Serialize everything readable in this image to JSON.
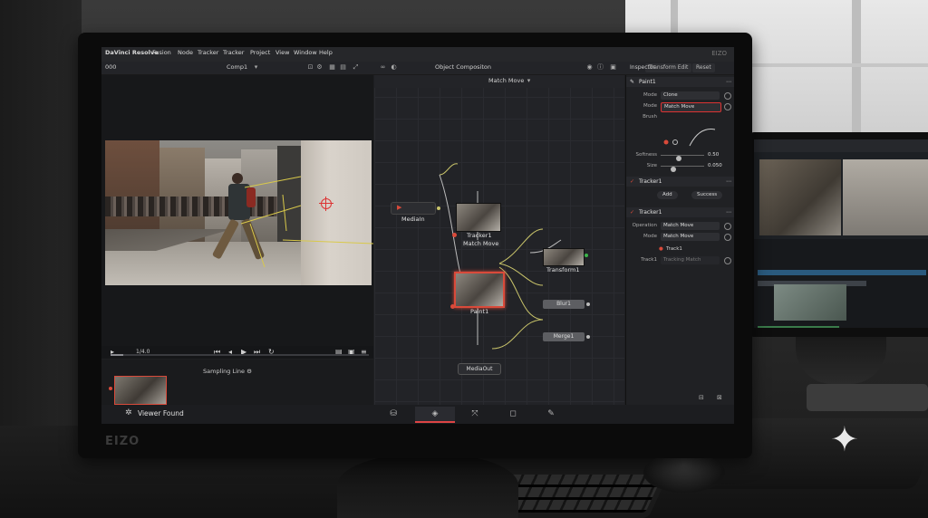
{
  "monitor": {
    "brand": "EIZO"
  },
  "menubar": {
    "items": [
      "DaVinci Resolve",
      "Fusion",
      "Node",
      "Tracker",
      "Tracker",
      "Project",
      "View",
      "Window",
      "Help"
    ]
  },
  "toolbar": {
    "left_label": "000",
    "viewer_name": "Comp1",
    "comp_title": "Object Compositon",
    "match_move_label": "Match Move",
    "inspector_tab": "Inspector",
    "transform_tab": "Transform Edit",
    "reset_button": "Reset"
  },
  "viewer": {
    "frame_counter": "1/4.0",
    "sampling_label": "Sampling Line",
    "playhead_fraction": 0.05
  },
  "statusbar": {
    "viewer_status": "Viewer Found"
  },
  "nodes": {
    "media_in": "MediaIn",
    "tracker": "Tracker1",
    "tracker_sub": "Match Move",
    "paint": "Paint1",
    "transform": "Transform1",
    "blur": "Blur1",
    "merge": "Merge1",
    "media_out": "MediaOut"
  },
  "inspector": {
    "paint_section": "Paint1",
    "mode1_label": "Mode",
    "mode1_value": "Clone",
    "mode2_label": "Mode",
    "mode2_value": "Match Move",
    "brush_label": "Brush",
    "softness_label": "Softness",
    "softness_value": "0.50",
    "size_label": "Size",
    "size_value": "0.050",
    "softness_fraction": 0.35,
    "size_fraction": 0.22,
    "tracker_section": "Tracker1",
    "add_button": "Add",
    "remove_button": "Success",
    "tracker2_section": "Tracker1",
    "operation_label": "Operation",
    "operation_value": "Match Move",
    "mode3_label": "Mode",
    "mode3_value": "Match Move",
    "track_item": "Track1",
    "track_label": "Track1",
    "track_value": "Tracking Match"
  },
  "colors": {
    "accent": "#d94a3a",
    "wire": "#c9c46a",
    "node_selected": "#d94a3a"
  },
  "icons": [
    "play-icon",
    "skip-back-icon",
    "skip-forward-icon",
    "step-back-icon",
    "step-forward-icon",
    "loop-icon",
    "gear-icon",
    "plus-icon"
  ]
}
